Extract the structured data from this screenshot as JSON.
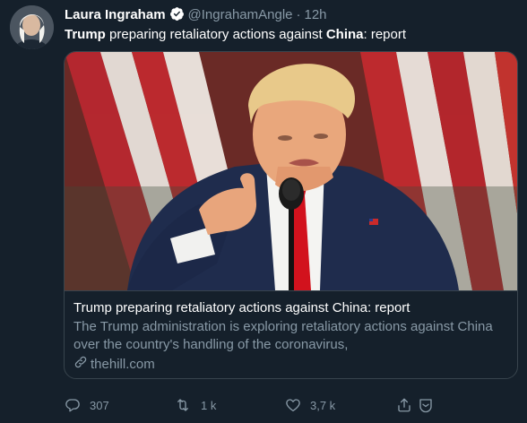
{
  "tweet": {
    "author_name": "Laura Ingraham",
    "handle": "@IngrahamAngle",
    "separator": "·",
    "time": "12h",
    "text_parts": [
      "Trump",
      " preparing retaliatory actions against ",
      "China",
      ": report"
    ]
  },
  "card": {
    "title": "Trump preparing retaliatory actions against China: report",
    "description": "The Trump administration is exploring retaliatory actions against China over the country's handling of the coronavirus,",
    "domain": "thehill.com"
  },
  "actions": {
    "reply_count": "307",
    "retweet_count": "1 k",
    "like_count": "3,7 k"
  },
  "colors": {
    "background": "#15202b",
    "muted_text": "#8899a6",
    "border": "#38444d",
    "verified": "#ffffff"
  },
  "icons": [
    "verified-badge-icon",
    "link-icon",
    "reply-icon",
    "retweet-icon",
    "like-icon",
    "share-icon",
    "bookmark-icon"
  ]
}
